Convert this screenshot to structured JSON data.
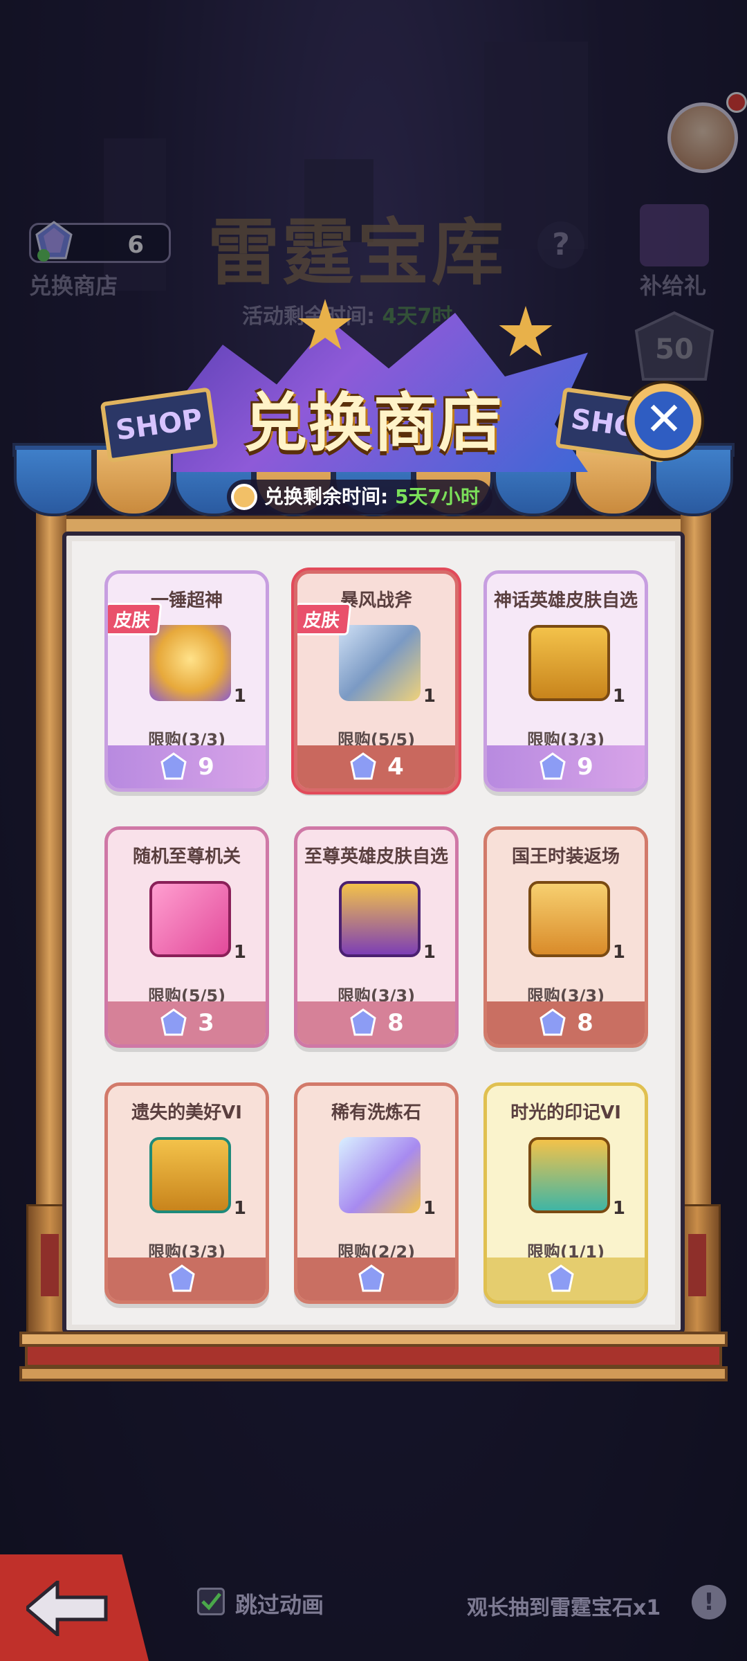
{
  "background": {
    "currency_count": "6",
    "exchange_shop_label": "兑换商店",
    "event_title": "雷霆宝库",
    "event_timer_label": "活动剩余时间:",
    "event_timer_value": "4天7时",
    "supply_gift_label": "补给礼",
    "badge_level": "50",
    "help_icon": "?"
  },
  "modal": {
    "title": "兑换商店",
    "shop_sign_left": "SHOP",
    "shop_sign_right": "SHOP",
    "close_icon": "✕",
    "timer_label": "兑换剩余时间:",
    "timer_value": "5天7小时"
  },
  "items": [
    {
      "name": "一锤超神",
      "tag": "皮肤",
      "qty": "1",
      "limit": "限购(3/3)",
      "price": "9"
    },
    {
      "name": "暴风战斧",
      "tag": "皮肤",
      "qty": "1",
      "limit": "限购(5/5)",
      "price": "4"
    },
    {
      "name": "神话英雄皮肤自选",
      "tag": "",
      "qty": "1",
      "limit": "限购(3/3)",
      "price": "9"
    },
    {
      "name": "随机至尊机关",
      "tag": "",
      "qty": "1",
      "limit": "限购(5/5)",
      "price": "3"
    },
    {
      "name": "至尊英雄皮肤自选",
      "tag": "",
      "qty": "1",
      "limit": "限购(3/3)",
      "price": "8"
    },
    {
      "name": "国王时装返场",
      "tag": "",
      "qty": "1",
      "limit": "限购(3/3)",
      "price": "8"
    },
    {
      "name": "遗失的美好VI",
      "tag": "",
      "qty": "1",
      "limit": "限购(3/3)",
      "price": ""
    },
    {
      "name": "稀有洗炼石",
      "tag": "",
      "qty": "1",
      "limit": "限购(2/2)",
      "price": ""
    },
    {
      "name": "时光的印记VI",
      "tag": "",
      "qty": "1",
      "limit": "限购(1/1)",
      "price": ""
    }
  ],
  "bottom_bar": {
    "skip_animation_label": "跳过动画",
    "watch_ad_label": "观长抽到雷霆宝石x1",
    "info_icon": "!"
  },
  "colors": {
    "accent_green": "#7be05a",
    "tag_red": "#e9506b",
    "back_button": "#c0302a"
  },
  "icons": [
    "gem-icon",
    "clock-icon",
    "close-icon",
    "back-arrow-icon",
    "checkbox-icon",
    "info-icon",
    "help-icon",
    "gift-icon",
    "avatar"
  ]
}
